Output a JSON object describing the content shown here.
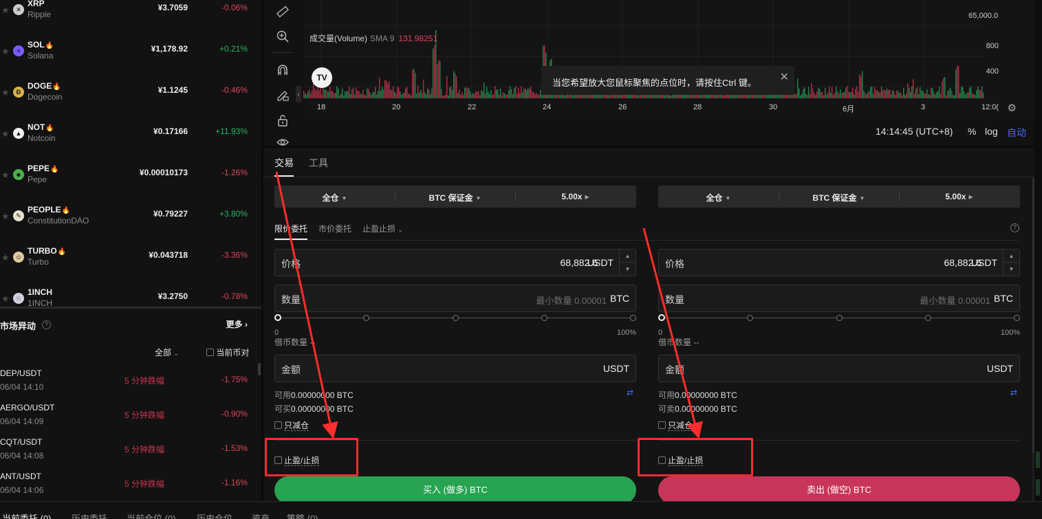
{
  "coins": [
    {
      "symbol": "XRP",
      "name": "Ripple",
      "price": "¥3.7059",
      "change": "-0.06%",
      "trend": "down",
      "hot": false,
      "logo_color": "#cccccc",
      "logo_char": "✕"
    },
    {
      "symbol": "SOL",
      "name": "Solana",
      "price": "¥1,178.92",
      "change": "+0.21%",
      "trend": "up",
      "hot": true,
      "logo_color": "#7b5cff",
      "logo_char": "≡"
    },
    {
      "symbol": "DOGE",
      "name": "Dogecoin",
      "price": "¥1.1245",
      "change": "-0.46%",
      "trend": "down",
      "hot": true,
      "logo_color": "#d8b24a",
      "logo_char": "Ð"
    },
    {
      "symbol": "NOT",
      "name": "Notcoin",
      "price": "¥0.17166",
      "change": "+11.93%",
      "trend": "up",
      "hot": true,
      "logo_color": "#f0f0f0",
      "logo_char": "▲"
    },
    {
      "symbol": "PEPE",
      "name": "Pepe",
      "price": "¥0.00010173",
      "change": "-1.26%",
      "trend": "down",
      "hot": true,
      "logo_color": "#4caf50",
      "logo_char": "☻"
    },
    {
      "symbol": "PEOPLE",
      "name": "ConstitutionDAO",
      "price": "¥0.79227",
      "change": "+3.80%",
      "trend": "up",
      "hot": true,
      "logo_color": "#e9e2d0",
      "logo_char": "✎"
    },
    {
      "symbol": "TURBO",
      "name": "Turbo",
      "price": "¥0.043718",
      "change": "-3.36%",
      "trend": "down",
      "hot": true,
      "logo_color": "#e0c9a0",
      "logo_char": "☺"
    },
    {
      "symbol": "1INCH",
      "name": "1INCH",
      "price": "¥3.2750",
      "change": "-0.78%",
      "trend": "down",
      "hot": false,
      "logo_color": "#d0d0e0",
      "logo_char": "♘"
    }
  ],
  "movers": {
    "title": "市场异动",
    "more": "更多",
    "filter": "全部",
    "current_pair": "当前币对",
    "rows": [
      {
        "pair": "DEP/USDT",
        "time": "06/04 14:10",
        "desc": "5 分钟跌幅",
        "change": "-1.75%"
      },
      {
        "pair": "AERGO/USDT",
        "time": "06/04 14:09",
        "desc": "5 分钟跌幅",
        "change": "-0.90%"
      },
      {
        "pair": "CQT/USDT",
        "time": "06/04 14:08",
        "desc": "5 分钟跌幅",
        "change": "-1.53%"
      },
      {
        "pair": "ANT/USDT",
        "time": "06/04 14:06",
        "desc": "5 分钟跌幅",
        "change": "-1.16%"
      }
    ]
  },
  "chart": {
    "volume_label": "成交量(Volume)",
    "sma_label": "SMA 9",
    "sma_value": "131.98251",
    "y_labels": [
      "65,000.0",
      "800",
      "400"
    ],
    "x_labels": [
      "18",
      "20",
      "22",
      "24",
      "26",
      "28",
      "30",
      "6月",
      "3",
      "12:0("
    ],
    "tooltip": "当您希望放大您鼠标聚焦的点位时，请按住Ctrl 键。",
    "clock": "14:14:45 (UTC+8)",
    "pct_btn": "%",
    "log_btn": "log",
    "auto_btn": "自动",
    "tv_logo": "TV",
    "bar_up_color": "#26a65b",
    "bar_down_color": "#d13b55"
  },
  "trade": {
    "tabs": [
      "交易",
      "工具"
    ],
    "order_tabs": [
      "限价委托",
      "市价委托",
      "止盈止损"
    ],
    "buy": {
      "margin_mode": "全仓",
      "margin_asset": "BTC 保证金",
      "leverage": "5.00x",
      "price_label": "价格",
      "price_value": "68,882.6",
      "price_unit": "USDT",
      "qty_label": "数量",
      "qty_placeholder": "最小数量 0.00001",
      "qty_unit": "BTC",
      "pct_min": "0",
      "pct_max": "100%",
      "borrow": "借币数量 --",
      "amount_label": "金额",
      "amount_unit": "USDT",
      "avail_label": "可用",
      "avail_value": "0.00000000 BTC",
      "max_label": "可买",
      "max_value": "0.00000000 BTC",
      "reduce_only": "只减仓",
      "tpsl": "止盈/止损",
      "button": "买入 (做多) BTC"
    },
    "sell": {
      "margin_mode": "全仓",
      "margin_asset": "BTC 保证金",
      "leverage": "5.00x",
      "price_label": "价格",
      "price_value": "68,882.6",
      "price_unit": "USDT",
      "qty_label": "数量",
      "qty_placeholder": "最小数量 0.00001",
      "qty_unit": "BTC",
      "pct_min": "0",
      "pct_max": "100%",
      "borrow": "借币数量 --",
      "amount_label": "金额",
      "amount_unit": "USDT",
      "avail_label": "可用",
      "avail_value": "0.00000000 BTC",
      "max_label": "可卖",
      "max_value": "0.00000000 BTC",
      "reduce_only": "只减仓",
      "tpsl": "止盈/止损",
      "button": "卖出 (做空) BTC"
    }
  },
  "bottom_tabs": [
    "当前委托 (0)",
    "历史委托",
    "当前仓位 (0)",
    "历史仓位",
    "资产",
    "策略 (0)"
  ],
  "colors": {
    "buy": "#27a351",
    "sell": "#c7365a",
    "annotation": "#ff2d2d",
    "accent_blue": "#3b6cff"
  }
}
